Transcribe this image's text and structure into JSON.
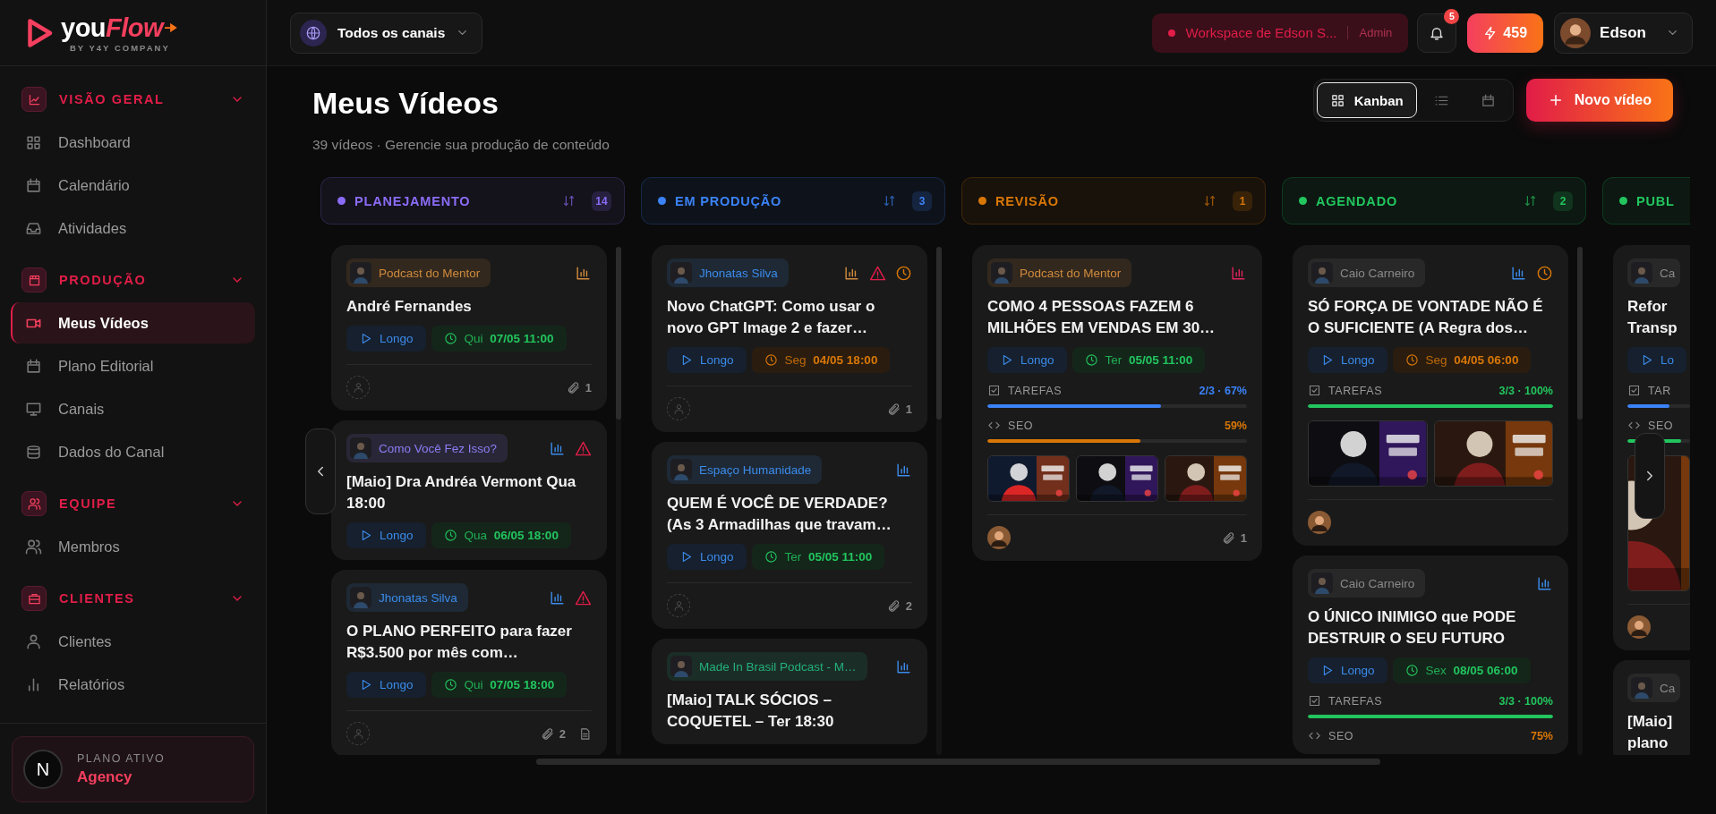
{
  "brand": {
    "name": "you",
    "name_accent": "Flow",
    "tagline": "BY Y4Y COMPANY"
  },
  "sidebar": {
    "sections": [
      {
        "title": "VISÃO GERAL",
        "expanded": true,
        "items": [
          {
            "label": "Dashboard",
            "selected": false
          },
          {
            "label": "Calendário",
            "selected": false
          },
          {
            "label": "Atividades",
            "selected": false
          }
        ]
      },
      {
        "title": "PRODUÇÃO",
        "expanded": true,
        "items": [
          {
            "label": "Meus Vídeos",
            "selected": true
          },
          {
            "label": "Plano Editorial",
            "selected": false
          },
          {
            "label": "Canais",
            "selected": false
          },
          {
            "label": "Dados do Canal",
            "selected": false
          }
        ]
      },
      {
        "title": "EQUIPE",
        "expanded": true,
        "items": [
          {
            "label": "Membros",
            "selected": false
          }
        ]
      },
      {
        "title": "CLIENTES",
        "expanded": true,
        "items": [
          {
            "label": "Clientes",
            "selected": false
          },
          {
            "label": "Relatórios",
            "selected": false
          }
        ]
      }
    ]
  },
  "plan": {
    "avatar": "N",
    "label": "PLANO ATIVO",
    "name": "Agency"
  },
  "topbar": {
    "channel_picker": "Todos os canais",
    "workspace": "Workspace de Edson S...",
    "role": "Admin",
    "notifications": "5",
    "credits": "459",
    "user": "Edson"
  },
  "page": {
    "title": "Meus Vídeos",
    "subtitle": "39 vídeos · Gerencie sua produção de conteúdo",
    "views": [
      {
        "label": "Kanban",
        "selected": true
      },
      {
        "selected": false
      },
      {
        "selected": false
      }
    ],
    "new_button": "Novo vídeo"
  },
  "columns": [
    {
      "title": "PLANEJAMENTO",
      "color": "#8b6cf6",
      "count": "14",
      "cards": [
        {
          "channel": {
            "name": "Podcast do Mentor",
            "color": "#d08a3c"
          },
          "icons": [
            {
              "kind": "stats",
              "color": "#d08a3c"
            }
          ],
          "title": "André Fernandes",
          "format": "Longo",
          "date": {
            "day": "Qui",
            "time": "07/05 11:00",
            "late": false
          },
          "footer": {
            "assigned": false,
            "attachments": "1"
          }
        },
        {
          "channel": {
            "name": "Como Você Fez Isso?",
            "color": "#8b7cf6"
          },
          "icons": [
            {
              "kind": "stats",
              "color": "#3b8bea"
            },
            {
              "kind": "warning",
              "color": "#e11d48"
            }
          ],
          "title": "[Maio] Dra Andréa Vermont Qua 18:00",
          "format": "Longo",
          "date": {
            "day": "Qua",
            "time": "06/05 18:00",
            "late": false
          }
        },
        {
          "channel": {
            "name": "Jhonatas Silva",
            "color": "#3b8bea"
          },
          "icons": [
            {
              "kind": "stats",
              "color": "#3b8bea"
            },
            {
              "kind": "warning",
              "color": "#e11d48"
            }
          ],
          "title": "O PLANO PERFEITO para fazer R$3.500 por mês com…",
          "format": "Longo",
          "date": {
            "day": "Qui",
            "time": "07/05 18:00",
            "late": false
          },
          "footer": {
            "assigned": false,
            "attachments": "2",
            "document": true
          }
        }
      ]
    },
    {
      "title": "EM PRODUÇÃO",
      "color": "#3b82f6",
      "count": "3",
      "cards": [
        {
          "channel": {
            "name": "Jhonatas Silva",
            "color": "#3b8bea"
          },
          "icons": [
            {
              "kind": "stats",
              "color": "#d08a3c"
            },
            {
              "kind": "warning",
              "color": "#e11d48"
            },
            {
              "kind": "clock",
              "color": "#d97706"
            }
          ],
          "title": "Novo ChatGPT: Como usar o novo GPT Image 2 e fazer…",
          "format": "Longo",
          "date": {
            "day": "Seg",
            "time": "04/05 18:00",
            "late": true
          },
          "footer": {
            "assigned": false,
            "attachments": "1"
          }
        },
        {
          "channel": {
            "name": "Espaço Humanidade",
            "color": "#3b8bea"
          },
          "icons": [
            {
              "kind": "stats",
              "color": "#3b8bea"
            }
          ],
          "title": "QUEM É VOCÊ DE VERDADE? (As 3 Armadilhas que travam…",
          "format": "Longo",
          "date": {
            "day": "Ter",
            "time": "05/05 11:00",
            "late": false
          },
          "footer": {
            "assigned": false,
            "attachments": "2"
          }
        },
        {
          "channel": {
            "name": "Made In Brasil Podcast - M…",
            "color": "#22b07d"
          },
          "icons": [
            {
              "kind": "stats",
              "color": "#3b8bea"
            }
          ],
          "title": "[Maio] TALK SÓCIOS – COQUETEL – Ter 18:30"
        }
      ]
    },
    {
      "title": "REVISÃO",
      "color": "#d97706",
      "count": "1",
      "cards": [
        {
          "channel": {
            "name": "Podcast do Mentor",
            "color": "#d08a3c"
          },
          "icons": [
            {
              "kind": "stats",
              "color": "#e0245e"
            }
          ],
          "title": "COMO 4 PESSOAS FAZEM 6 MILHÕES EM VENDAS EM 30…",
          "format": "Longo",
          "date": {
            "day": "Ter",
            "time": "05/05 11:00",
            "late": false
          },
          "tasks": {
            "label": "TAREFAS",
            "reading": "2/3 · 67%",
            "level": 0.67
          },
          "seo": {
            "label": "SEO",
            "reading": "59%",
            "level": 0.59
          },
          "thumbnails": [
            {
              "kind": "picture"
            },
            {
              "kind": "picture"
            },
            {
              "kind": "picture"
            }
          ],
          "footer": {
            "assigned": true,
            "attachments": "1"
          }
        }
      ]
    },
    {
      "title": "AGENDADO",
      "color": "#22c55e",
      "count": "2",
      "cards": [
        {
          "channel": {
            "name": "Caio Carneiro",
            "color": "#8a8a8a"
          },
          "icons": [
            {
              "kind": "stats",
              "color": "#3b8bea"
            },
            {
              "kind": "clock",
              "color": "#d97706"
            }
          ],
          "title": "SÓ FORÇA DE VONTADE NÃO É O SUFICIENTE (A Regra dos…",
          "format": "Longo",
          "date": {
            "day": "Seg",
            "time": "04/05 06:00",
            "late": true
          },
          "tasks": {
            "label": "TAREFAS",
            "reading": "3/3 · 100%",
            "level": 1
          },
          "thumbnails": [
            {
              "kind": "picture"
            },
            {
              "kind": "picture"
            }
          ],
          "footer": {
            "assigned": true
          }
        },
        {
          "channel": {
            "name": "Caio Carneiro",
            "color": "#8a8a8a"
          },
          "icons": [
            {
              "kind": "stats",
              "color": "#3b8bea"
            }
          ],
          "title": "O ÚNICO INIMIGO que PODE DESTRUIR O SEU FUTURO",
          "format": "Longo",
          "date": {
            "day": "Sex",
            "time": "08/05 06:00",
            "late": false
          },
          "tasks": {
            "label": "TAREFAS",
            "reading": "3/3 · 100%",
            "level": 1
          },
          "seo": {
            "label": "SEO",
            "reading": "75%"
          }
        }
      ]
    },
    {
      "title": "PUBL",
      "color": "#22c55e",
      "cards": [
        {
          "channel": {
            "name": "Ca",
            "color": "#8a8a8a"
          },
          "title": "Refor Transp",
          "format": "Lo",
          "tasks": {
            "label": "TAR",
            "level": 0.67
          },
          "seo": {
            "label": "SEO",
            "level": 0.85
          },
          "thumbnails": [
            {
              "kind": "picture"
            }
          ],
          "footer": {
            "assigned": true
          }
        },
        {
          "channel": {
            "name": "Ca",
            "color": "#8a8a8a"
          },
          "title": "[Maio] plano"
        }
      ]
    }
  ]
}
